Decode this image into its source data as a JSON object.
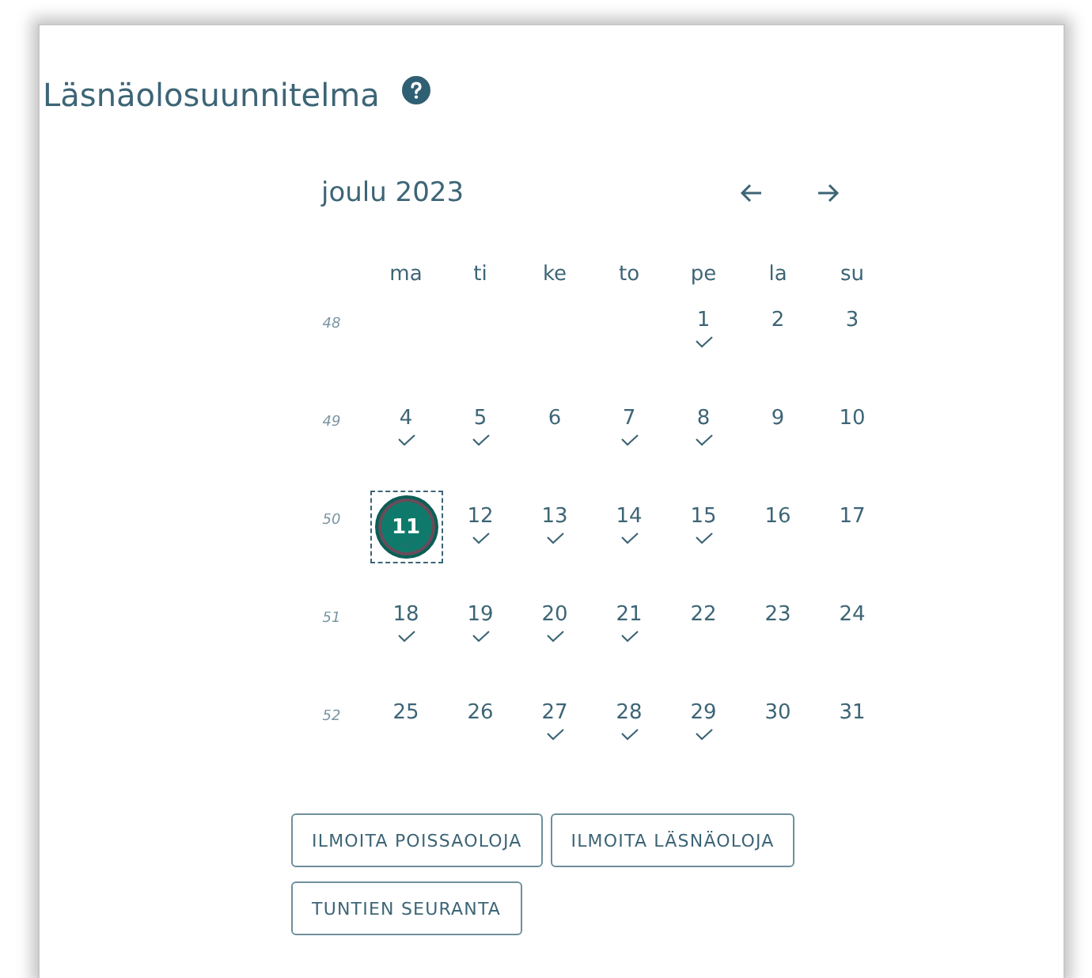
{
  "title": "Läsnäolosuunnitelma",
  "help_icon": true,
  "calendar": {
    "month": "joulu 2023",
    "weekdays": [
      "ma",
      "ti",
      "ke",
      "to",
      "pe",
      "la",
      "su"
    ],
    "weeks": [
      {
        "number": "48",
        "days": [
          {
            "kind": "blank"
          },
          {
            "kind": "blank"
          },
          {
            "kind": "blank"
          },
          {
            "kind": "blank"
          },
          {
            "kind": "day",
            "label": "1",
            "checked": true,
            "selected": false
          },
          {
            "kind": "day",
            "label": "2",
            "checked": false,
            "selected": false
          },
          {
            "kind": "day",
            "label": "3",
            "checked": false,
            "selected": false
          }
        ]
      },
      {
        "number": "49",
        "days": [
          {
            "kind": "day",
            "label": "4",
            "checked": true,
            "selected": false
          },
          {
            "kind": "day",
            "label": "5",
            "checked": true,
            "selected": false
          },
          {
            "kind": "day",
            "label": "6",
            "checked": false,
            "selected": false
          },
          {
            "kind": "day",
            "label": "7",
            "checked": true,
            "selected": false
          },
          {
            "kind": "day",
            "label": "8",
            "checked": true,
            "selected": false
          },
          {
            "kind": "day",
            "label": "9",
            "checked": false,
            "selected": false
          },
          {
            "kind": "day",
            "label": "10",
            "checked": false,
            "selected": false
          }
        ]
      },
      {
        "number": "50",
        "days": [
          {
            "kind": "day",
            "label": "11",
            "checked": true,
            "selected": true
          },
          {
            "kind": "day",
            "label": "12",
            "checked": true,
            "selected": false
          },
          {
            "kind": "day",
            "label": "13",
            "checked": true,
            "selected": false
          },
          {
            "kind": "day",
            "label": "14",
            "checked": true,
            "selected": false
          },
          {
            "kind": "day",
            "label": "15",
            "checked": true,
            "selected": false
          },
          {
            "kind": "day",
            "label": "16",
            "checked": false,
            "selected": false
          },
          {
            "kind": "day",
            "label": "17",
            "checked": false,
            "selected": false
          }
        ]
      },
      {
        "number": "51",
        "days": [
          {
            "kind": "day",
            "label": "18",
            "checked": true,
            "selected": false
          },
          {
            "kind": "day",
            "label": "19",
            "checked": true,
            "selected": false
          },
          {
            "kind": "day",
            "label": "20",
            "checked": true,
            "selected": false
          },
          {
            "kind": "day",
            "label": "21",
            "checked": true,
            "selected": false
          },
          {
            "kind": "day",
            "label": "22",
            "checked": false,
            "selected": false
          },
          {
            "kind": "day",
            "label": "23",
            "checked": false,
            "selected": false
          },
          {
            "kind": "day",
            "label": "24",
            "checked": false,
            "selected": false
          }
        ]
      },
      {
        "number": "52",
        "days": [
          {
            "kind": "day",
            "label": "25",
            "checked": false,
            "selected": false
          },
          {
            "kind": "day",
            "label": "26",
            "checked": false,
            "selected": false
          },
          {
            "kind": "day",
            "label": "27",
            "checked": true,
            "selected": false
          },
          {
            "kind": "day",
            "label": "28",
            "checked": true,
            "selected": false
          },
          {
            "kind": "day",
            "label": "29",
            "checked": true,
            "selected": false
          },
          {
            "kind": "day",
            "label": "30",
            "checked": false,
            "selected": false
          },
          {
            "kind": "day",
            "label": "31",
            "checked": false,
            "selected": false
          }
        ]
      }
    ]
  },
  "buttons": [
    "ILMOITA POISSAOLOJA",
    "ILMOITA LÄSNÄOLOJA",
    "TUNTIEN SEURANTA"
  ]
}
